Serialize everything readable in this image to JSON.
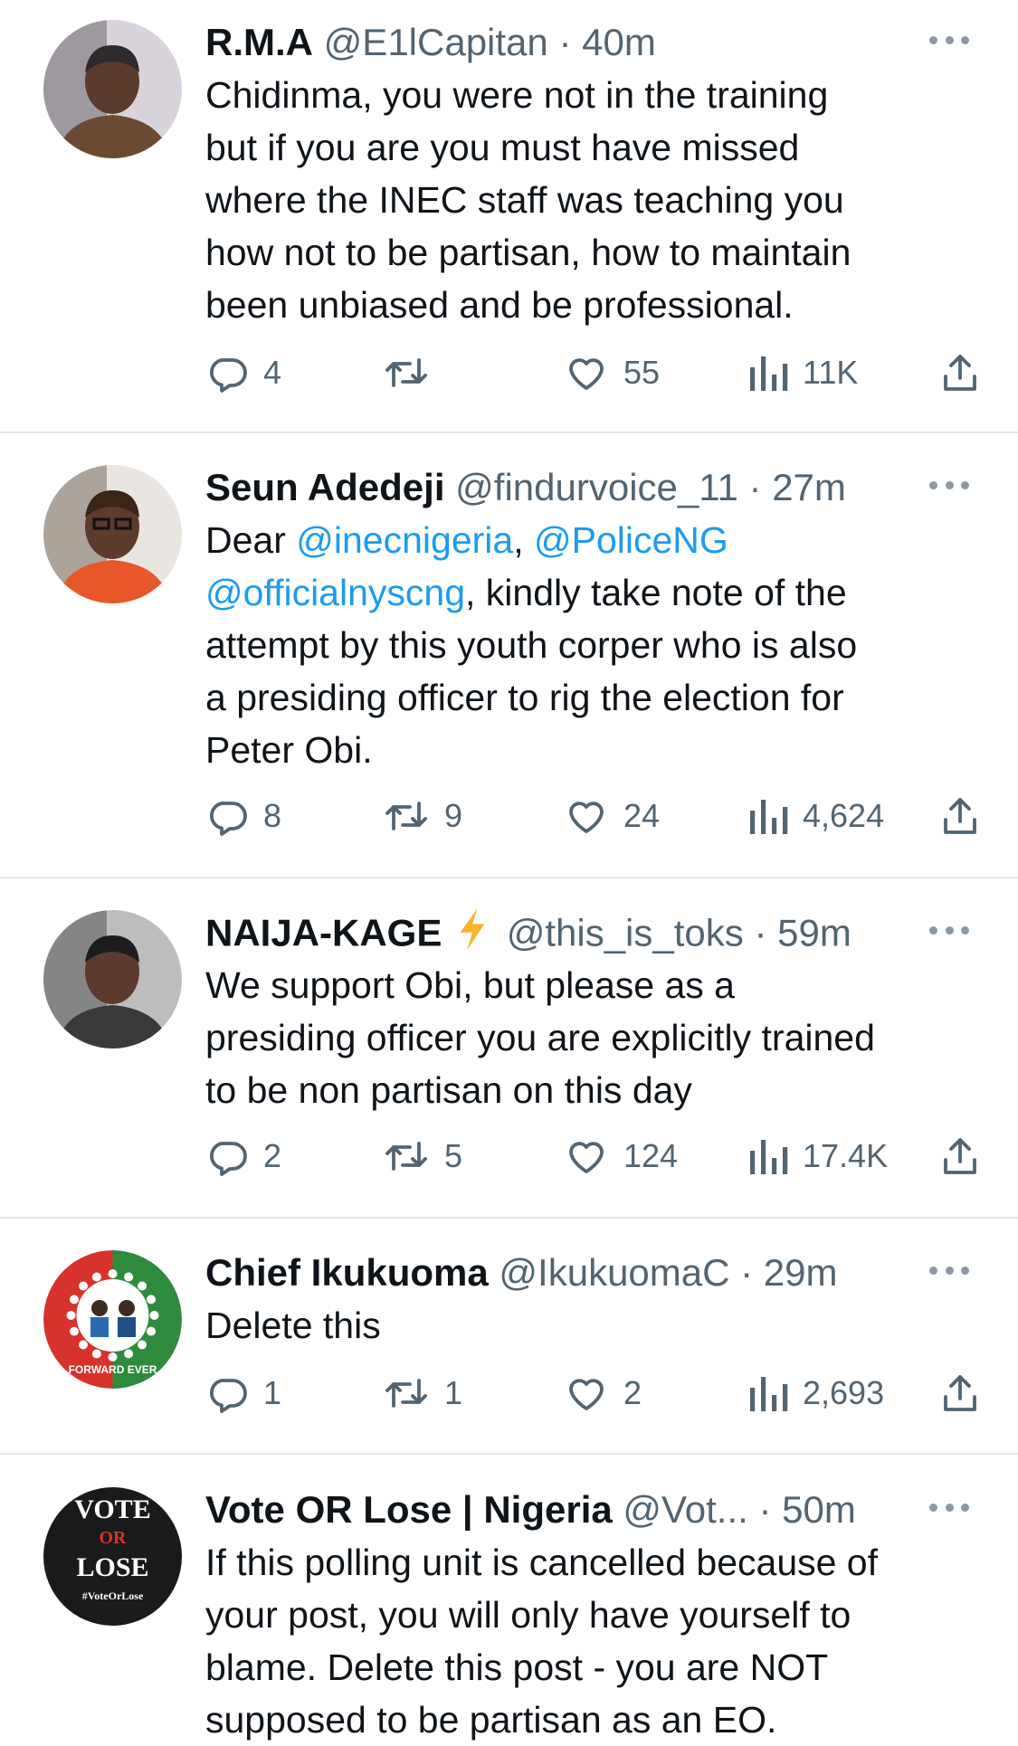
{
  "tweets": [
    {
      "name": "R.M.A",
      "emoji": "",
      "handle": "@E1lCapitan",
      "time": "40m",
      "text": [
        {
          "t": "Chidinma, you were not in the training\nbut if you are you must have missed\nwhere the INEC staff was teaching you\nhow not to be partisan, how to maintain\nbeen unbiased and be professional.",
          "mention": false
        }
      ],
      "replies": "4",
      "retweets": "",
      "likes": "55",
      "views": "11K",
      "avatar": {
        "type": "photo",
        "colors": [
          "#6b4a34",
          "#2e2a2c",
          "#d9d4dc"
        ]
      }
    },
    {
      "name": "Seun Adedeji",
      "emoji": "",
      "handle": "@findurvoice_11",
      "time": "27m",
      "text": [
        {
          "t": "Dear ",
          "mention": false
        },
        {
          "t": "@inecnigeria",
          "mention": true
        },
        {
          "t": ", ",
          "mention": false
        },
        {
          "t": "@PoliceNG",
          "mention": true
        },
        {
          "t": "\n",
          "mention": false
        },
        {
          "t": "@officialnyscng",
          "mention": true
        },
        {
          "t": ", kindly take note of the\nattempt by this youth corper who is also\na presiding officer to rig the election for\nPeter Obi.",
          "mention": false
        }
      ],
      "replies": "8",
      "retweets": "9",
      "likes": "24",
      "views": "4,624",
      "avatar": {
        "type": "photo",
        "colors": [
          "#e8572a",
          "#3b2418",
          "#e9e6e2"
        ]
      }
    },
    {
      "name": "NAIJA-KAGE",
      "emoji": "lightning",
      "handle": "@this_is_toks",
      "time": "59m",
      "text": [
        {
          "t": "We support Obi, but please as a\npresiding officer you are explicitly trained\nto be non partisan on this day",
          "mention": false
        }
      ],
      "replies": "2",
      "retweets": "5",
      "likes": "124",
      "views": "17.4K",
      "avatar": {
        "type": "photo",
        "colors": [
          "#3a3a3a",
          "#1c1c1c",
          "#bdbdbd"
        ]
      }
    },
    {
      "name": "Chief Ikukuoma",
      "emoji": "",
      "handle": "@IkukuomaC",
      "time": "29m",
      "text": [
        {
          "t": "Delete this",
          "mention": false
        }
      ],
      "replies": "1",
      "retweets": "1",
      "likes": "2",
      "views": "2,693",
      "avatar": {
        "type": "logo",
        "colors": [
          "#d8322c",
          "#2e8b3d",
          "#ffffff"
        ],
        "caption": "FORWARD EVER"
      }
    },
    {
      "name": "Vote OR Lose | Nigeria",
      "emoji": "",
      "handle": "@Vot...",
      "time": "50m",
      "text": [
        {
          "t": "If this polling unit is cancelled because of\nyour post, you will only have yourself to\nblame. Delete this post - you are NOT\nsupposed to be partisan as an EO.",
          "mention": false
        }
      ],
      "replies": "",
      "retweets": "",
      "likes": "",
      "views": "",
      "avatar": {
        "type": "logo",
        "colors": [
          "#1a1a1a",
          "#d8322c",
          "#ffffff"
        ],
        "lines": [
          "VOTE",
          "OR",
          "LOSE",
          "#VoteOrLose"
        ]
      }
    }
  ]
}
